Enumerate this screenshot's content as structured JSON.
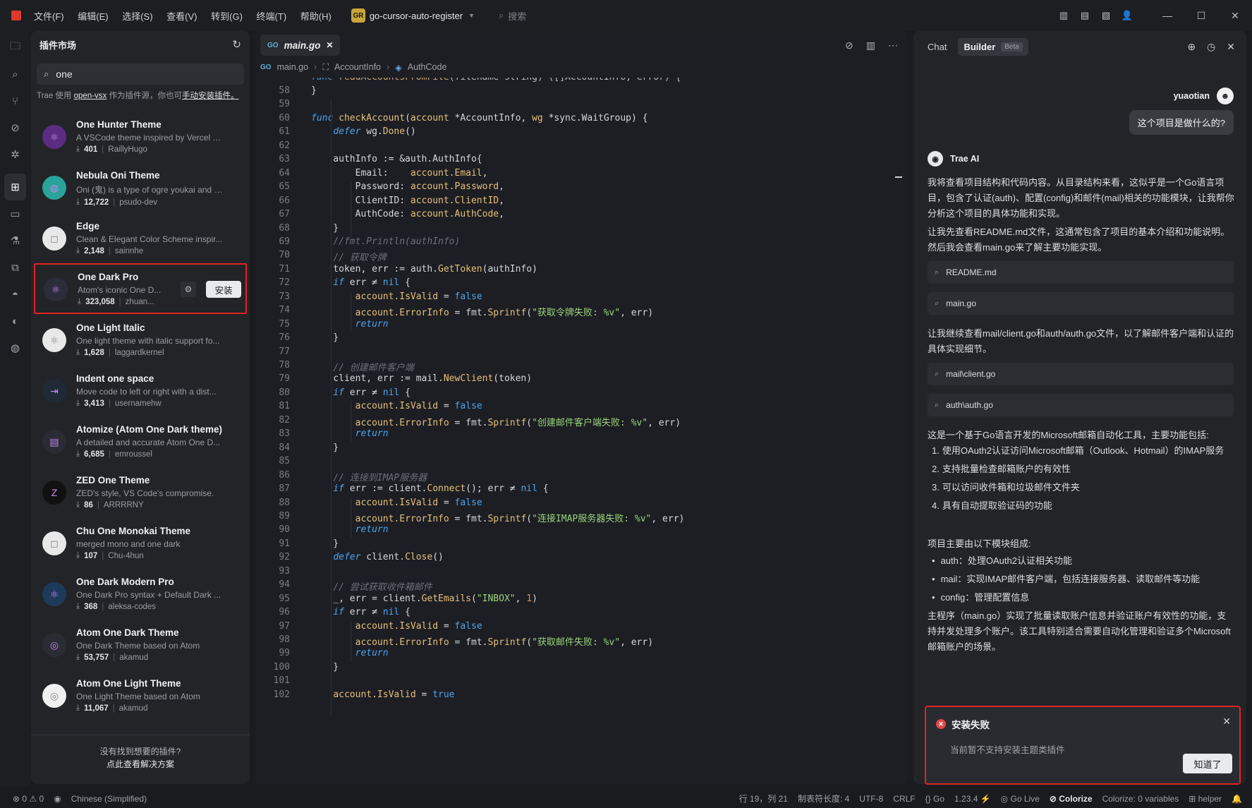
{
  "titlebar": {
    "menu": [
      "文件(F)",
      "编辑(E)",
      "选择(S)",
      "查看(V)",
      "转到(G)",
      "终端(T)",
      "帮助(H)"
    ],
    "project_badge": "GR",
    "project_name": "go-cursor-auto-register",
    "search_label": "搜索"
  },
  "sidebar": {
    "title": "插件市场",
    "search_value": "one",
    "note_prefix": "Trae 使用 ",
    "note_link1": "open-vsx",
    "note_mid": " 作为插件源，你也可",
    "note_link2": "手动安装插件。",
    "extensions": [
      {
        "name": "One Hunter Theme",
        "desc": "A VSCode theme inspired by Vercel T...",
        "downloads": "401",
        "author": "RaillyHugo",
        "icon": "atom-icon",
        "color": "#5a2d82"
      },
      {
        "name": "Nebula Oni Theme",
        "desc": "Oni (鬼) is a type of ogre youkai and \"...",
        "downloads": "12,722",
        "author": "psudo-dev",
        "icon": "planet-icon",
        "color": "#2aa39a"
      },
      {
        "name": "Edge",
        "desc": "Clean & Elegant Color Scheme inspir...",
        "downloads": "2,148",
        "author": "sainnhe",
        "icon": "edge-icon",
        "color": "#e8e8e8"
      },
      {
        "name": "One Dark Pro",
        "desc": "Atom's iconic One D...",
        "downloads": "323,058",
        "author": "zhuan...",
        "icon": "atom-icon",
        "color": "#2b2d3a"
      },
      {
        "name": "One Light Italic",
        "desc": "One light theme with italic support fo...",
        "downloads": "1,628",
        "author": "laggardkernel",
        "icon": "atom-icon",
        "color": "#e8e8e8"
      },
      {
        "name": "Indent one space",
        "desc": "Move code to left or right with a dist...",
        "downloads": "3,413",
        "author": "usernamehw",
        "icon": "indent-icon",
        "color": "#1f2a36"
      },
      {
        "name": "Atomize (Atom One Dark theme)",
        "desc": "A detailed and accurate Atom One D...",
        "downloads": "6,685",
        "author": "emroussel",
        "icon": "atomize-icon",
        "color": "#2a2c34"
      },
      {
        "name": "ZED One Theme",
        "desc": "ZED's style, VS Code's compromise.",
        "downloads": "86",
        "author": "ARRRRNY",
        "icon": "zed-icon",
        "color": "#111"
      },
      {
        "name": "Chu One Monokai Theme",
        "desc": "merged mono and one dark",
        "downloads": "107",
        "author": "Chu-4hun",
        "icon": "chu-icon",
        "color": "#e8e8e8"
      },
      {
        "name": "One Dark Modern Pro",
        "desc": "One Dark Pro syntax + Default Dark ...",
        "downloads": "368",
        "author": "aleksa-codes",
        "icon": "react-icon",
        "color": "#1e3a5a"
      },
      {
        "name": "Atom One Dark Theme",
        "desc": "One Dark Theme based on Atom",
        "downloads": "53,757",
        "author": "akamud",
        "icon": "ring-icon",
        "color": "#2a2c34"
      },
      {
        "name": "Atom One Light Theme",
        "desc": "One Light Theme based on Atom",
        "downloads": "11,067",
        "author": "akamud",
        "icon": "ring-icon",
        "color": "#f0f0f0"
      }
    ],
    "install_label": "安装",
    "footer_line1": "没有找到想要的插件?",
    "footer_line2": "点此查看解决方案"
  },
  "editor": {
    "tab_label": "main.go",
    "breadcrumb": [
      "main.go",
      "AccountInfo",
      "AuthCode"
    ],
    "first_line_fragment": "func readAccountsFromFile(filename string) ([]AccountInfo, error) {",
    "line_numbers": [
      "58",
      "59",
      "60",
      "61",
      "62",
      "63",
      "64",
      "65",
      "66",
      "67",
      "68",
      "69",
      "70",
      "71",
      "72",
      "73",
      "74",
      "75",
      "76",
      "77",
      "78",
      "79",
      "80",
      "81",
      "82",
      "83",
      "84",
      "85",
      "86",
      "87",
      "88",
      "89",
      "90",
      "91",
      "92",
      "93",
      "94",
      "95",
      "96",
      "97",
      "98",
      "99",
      "100",
      "101",
      "102"
    ]
  },
  "chat": {
    "tab_chat": "Chat",
    "tab_builder": "Builder",
    "beta": "Beta",
    "username": "yuaotian",
    "user_message": "这个项目是做什么的?",
    "ai_name": "Trae AI",
    "p1": "我将查看项目结构和代码内容。从目录结构来看，这似乎是一个Go语言项目，包含了认证(auth)、配置(config)和邮件(mail)相关的功能模块，让我帮你分析这个项目的具体功能和实现。",
    "p2": "让我先查看README.md文件，这通常包含了项目的基本介绍和功能说明。然后我会查看main.go来了解主要功能实现。",
    "file1": "README.md",
    "file2": "main.go",
    "p3": "让我继续查看mail/client.go和auth/auth.go文件，以了解邮件客户端和认证的具体实现细节。",
    "file3": "mail\\client.go",
    "file4": "auth\\auth.go",
    "p4": "这是一个基于Go语言开发的Microsoft邮箱自动化工具，主要功能包括:",
    "list1": [
      "使用OAuth2认证访问Microsoft邮箱（Outlook、Hotmail）的IMAP服务",
      "支持批量检查邮箱账户的有效性",
      "可以访问收件箱和垃圾邮件文件夹",
      "具有自动提取验证码的功能"
    ],
    "p5": "项目主要由以下模块组成:",
    "list2": [
      "auth：处理OAuth2认证相关功能",
      "mail：实现IMAP邮件客户端，包括连接服务器、读取邮件等功能",
      "config：管理配置信息"
    ],
    "p6": "主程序（main.go）实现了批量读取账户信息并验证账户有效性的功能，支持并发处理多个账户。该工具特别适合需要自动化管理和验证多个Microsoft邮箱账户的场景。"
  },
  "toast": {
    "title": "安装失败",
    "message": "当前暂不支持安装主题类插件",
    "button": "知道了"
  },
  "statusbar": {
    "problems": "0",
    "warnings": "0",
    "language_pack": "Chinese (Simplified)",
    "position": "行 19，列 21",
    "tab_size": "制表符长度: 4",
    "encoding": "UTF-8",
    "eol": "CRLF",
    "lang": "Go",
    "go_version": "1.23.4",
    "golive": "Go Live",
    "colorize": "Colorize",
    "colorize_vars": "Colorize: 0 variables",
    "helper": "helper"
  }
}
